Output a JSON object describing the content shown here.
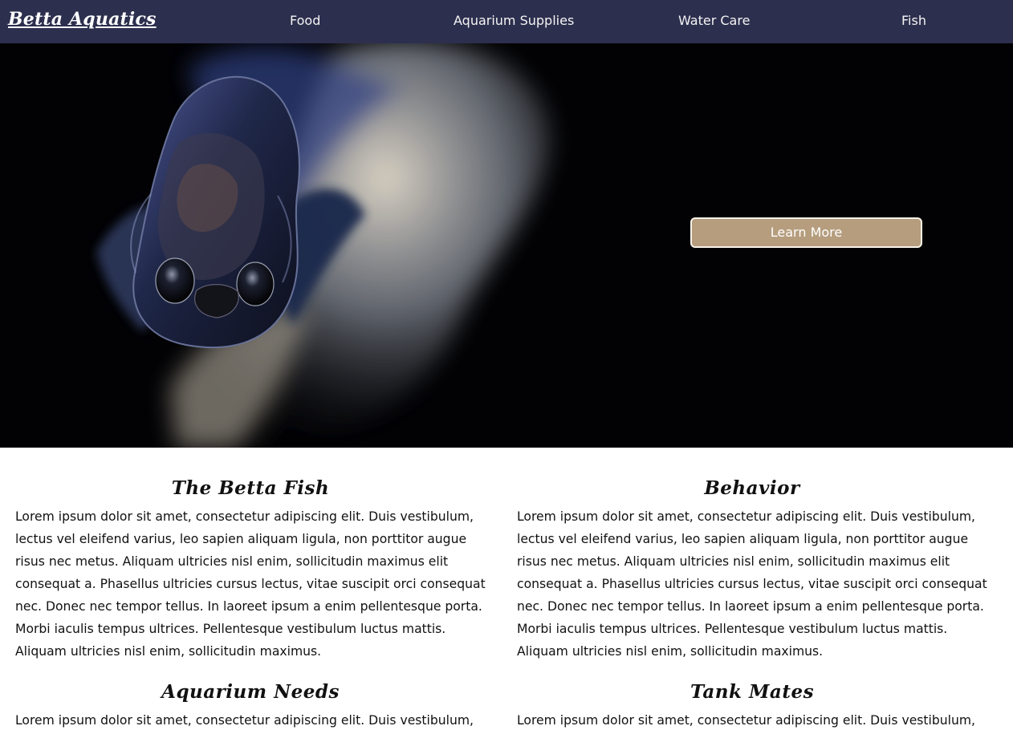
{
  "navbar": {
    "brand": "Betta Aquatics",
    "items": [
      {
        "label": "Food"
      },
      {
        "label": "Aquarium Supplies"
      },
      {
        "label": "Water Care"
      },
      {
        "label": "Fish"
      }
    ],
    "background_color": "#2d2f4e"
  },
  "hero": {
    "image_subject": "betta-fish",
    "button_label": "Learn More",
    "button_color": "#b59d7d",
    "background_color": "#020204"
  },
  "sections": [
    {
      "title": "The Betta Fish",
      "body": "Lorem ipsum dolor sit amet, consectetur adipiscing elit. Duis vestibulum, lectus vel eleifend varius, leo sapien aliquam ligula, non porttitor augue risus nec metus. Aliquam ultricies nisl enim, sollicitudin maximus elit consequat a. Phasellus ultricies cursus lectus, vitae suscipit orci consequat nec. Donec nec tempor tellus. In laoreet ipsum a enim pellentesque porta. Morbi iaculis tempus ultrices. Pellentesque vestibulum luctus mattis. Aliquam ultricies nisl enim, sollicitudin maximus."
    },
    {
      "title": "Behavior",
      "body": "Lorem ipsum dolor sit amet, consectetur adipiscing elit. Duis vestibulum, lectus vel eleifend varius, leo sapien aliquam ligula, non porttitor augue risus nec metus. Aliquam ultricies nisl enim, sollicitudin maximus elit consequat a. Phasellus ultricies cursus lectus, vitae suscipit orci consequat nec. Donec nec tempor tellus. In laoreet ipsum a enim pellentesque porta. Morbi iaculis tempus ultrices. Pellentesque vestibulum luctus mattis. Aliquam ultricies nisl enim, sollicitudin maximus."
    },
    {
      "title": "Aquarium Needs",
      "body": "Lorem ipsum dolor sit amet, consectetur adipiscing elit. Duis vestibulum, lectus vel"
    },
    {
      "title": "Tank Mates",
      "body": "Lorem ipsum dolor sit amet, consectetur adipiscing elit. Duis vestibulum, lectus vel"
    }
  ]
}
